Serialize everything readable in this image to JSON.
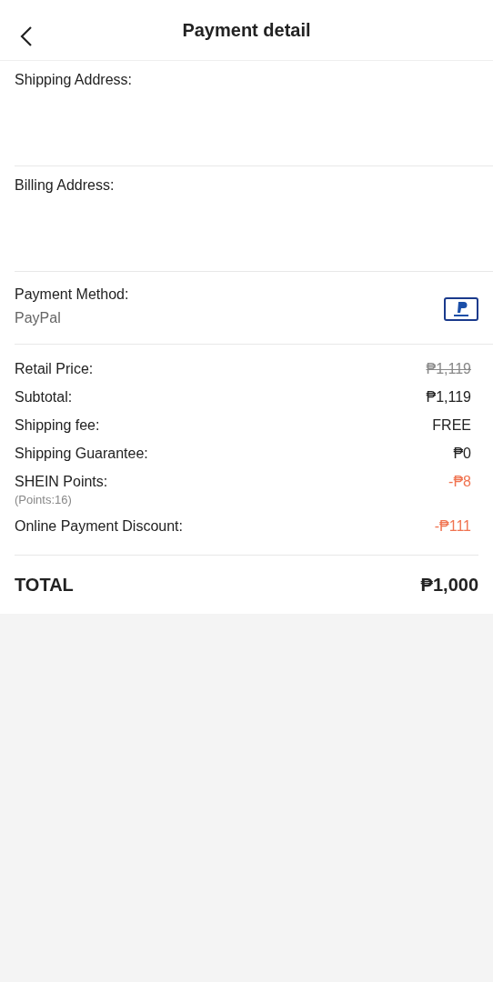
{
  "header": {
    "title": "Payment detail"
  },
  "shipping_address": {
    "label": "Shipping Address:"
  },
  "billing_address": {
    "label": "Billing Address:"
  },
  "payment_method": {
    "label": "Payment Method:",
    "value": "PayPal"
  },
  "price_rows": [
    {
      "label": "Retail Price:",
      "value": "₱1,119",
      "kind": "strike"
    },
    {
      "label": "Subtotal:",
      "value": "₱1,119",
      "kind": "normal"
    },
    {
      "label": "Shipping fee:",
      "value": "FREE",
      "kind": "normal"
    },
    {
      "label": "Shipping Guarantee:",
      "value": "₱0",
      "kind": "normal"
    },
    {
      "label": "SHEIN Points:",
      "note": "(Points:16)",
      "value": "-₱8",
      "kind": "discount"
    },
    {
      "label": "Online Payment Discount:",
      "value": "-₱111",
      "kind": "discount"
    }
  ],
  "total": {
    "label": "TOTAL",
    "value": "₱1,000"
  }
}
